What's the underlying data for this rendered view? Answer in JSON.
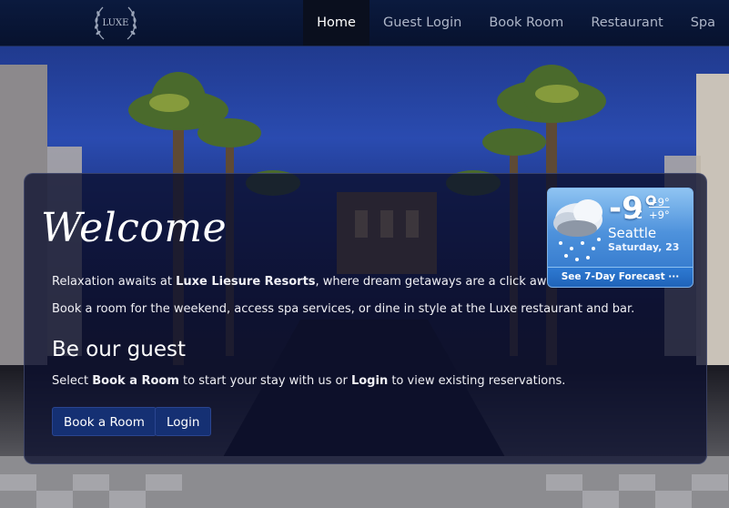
{
  "brand": {
    "logo_text": "LUXE"
  },
  "nav": {
    "items": [
      {
        "label": "Home",
        "active": true
      },
      {
        "label": "Guest Login"
      },
      {
        "label": "Book Room"
      },
      {
        "label": "Restaurant"
      },
      {
        "label": "Spa"
      }
    ]
  },
  "hero": {
    "heading": "Welcome",
    "intro": {
      "before": "Relaxation awaits at ",
      "brand": "Luxe Liesure Resorts",
      "after": ", where dream getaways are a click away."
    },
    "paragraph2": "Book a room for the weekend, access spa services, or dine in style at the Luxe restaurant and bar.",
    "subheading": "Be our guest",
    "instructions": {
      "part1": "Select ",
      "book_term": "Book a Room",
      "part2": " to start your stay with us or ",
      "login_term": "Login",
      "part3": " to view existing reservations."
    },
    "buttons": {
      "book": "Book a Room",
      "login": "Login"
    }
  },
  "weather": {
    "temperature": "-9°",
    "unit": "C",
    "high": "+9°",
    "low": "+9°",
    "city": "Seattle",
    "date": "Saturday, 23",
    "forecast_link": "See 7-Day Forecast ···",
    "icon": "cloud-rain-icon"
  },
  "colors": {
    "nav_bg": "#0b1a3e",
    "button_bg": "#153073",
    "panel_bg": "#0c102e",
    "weather_bg": "#4e92dc"
  }
}
